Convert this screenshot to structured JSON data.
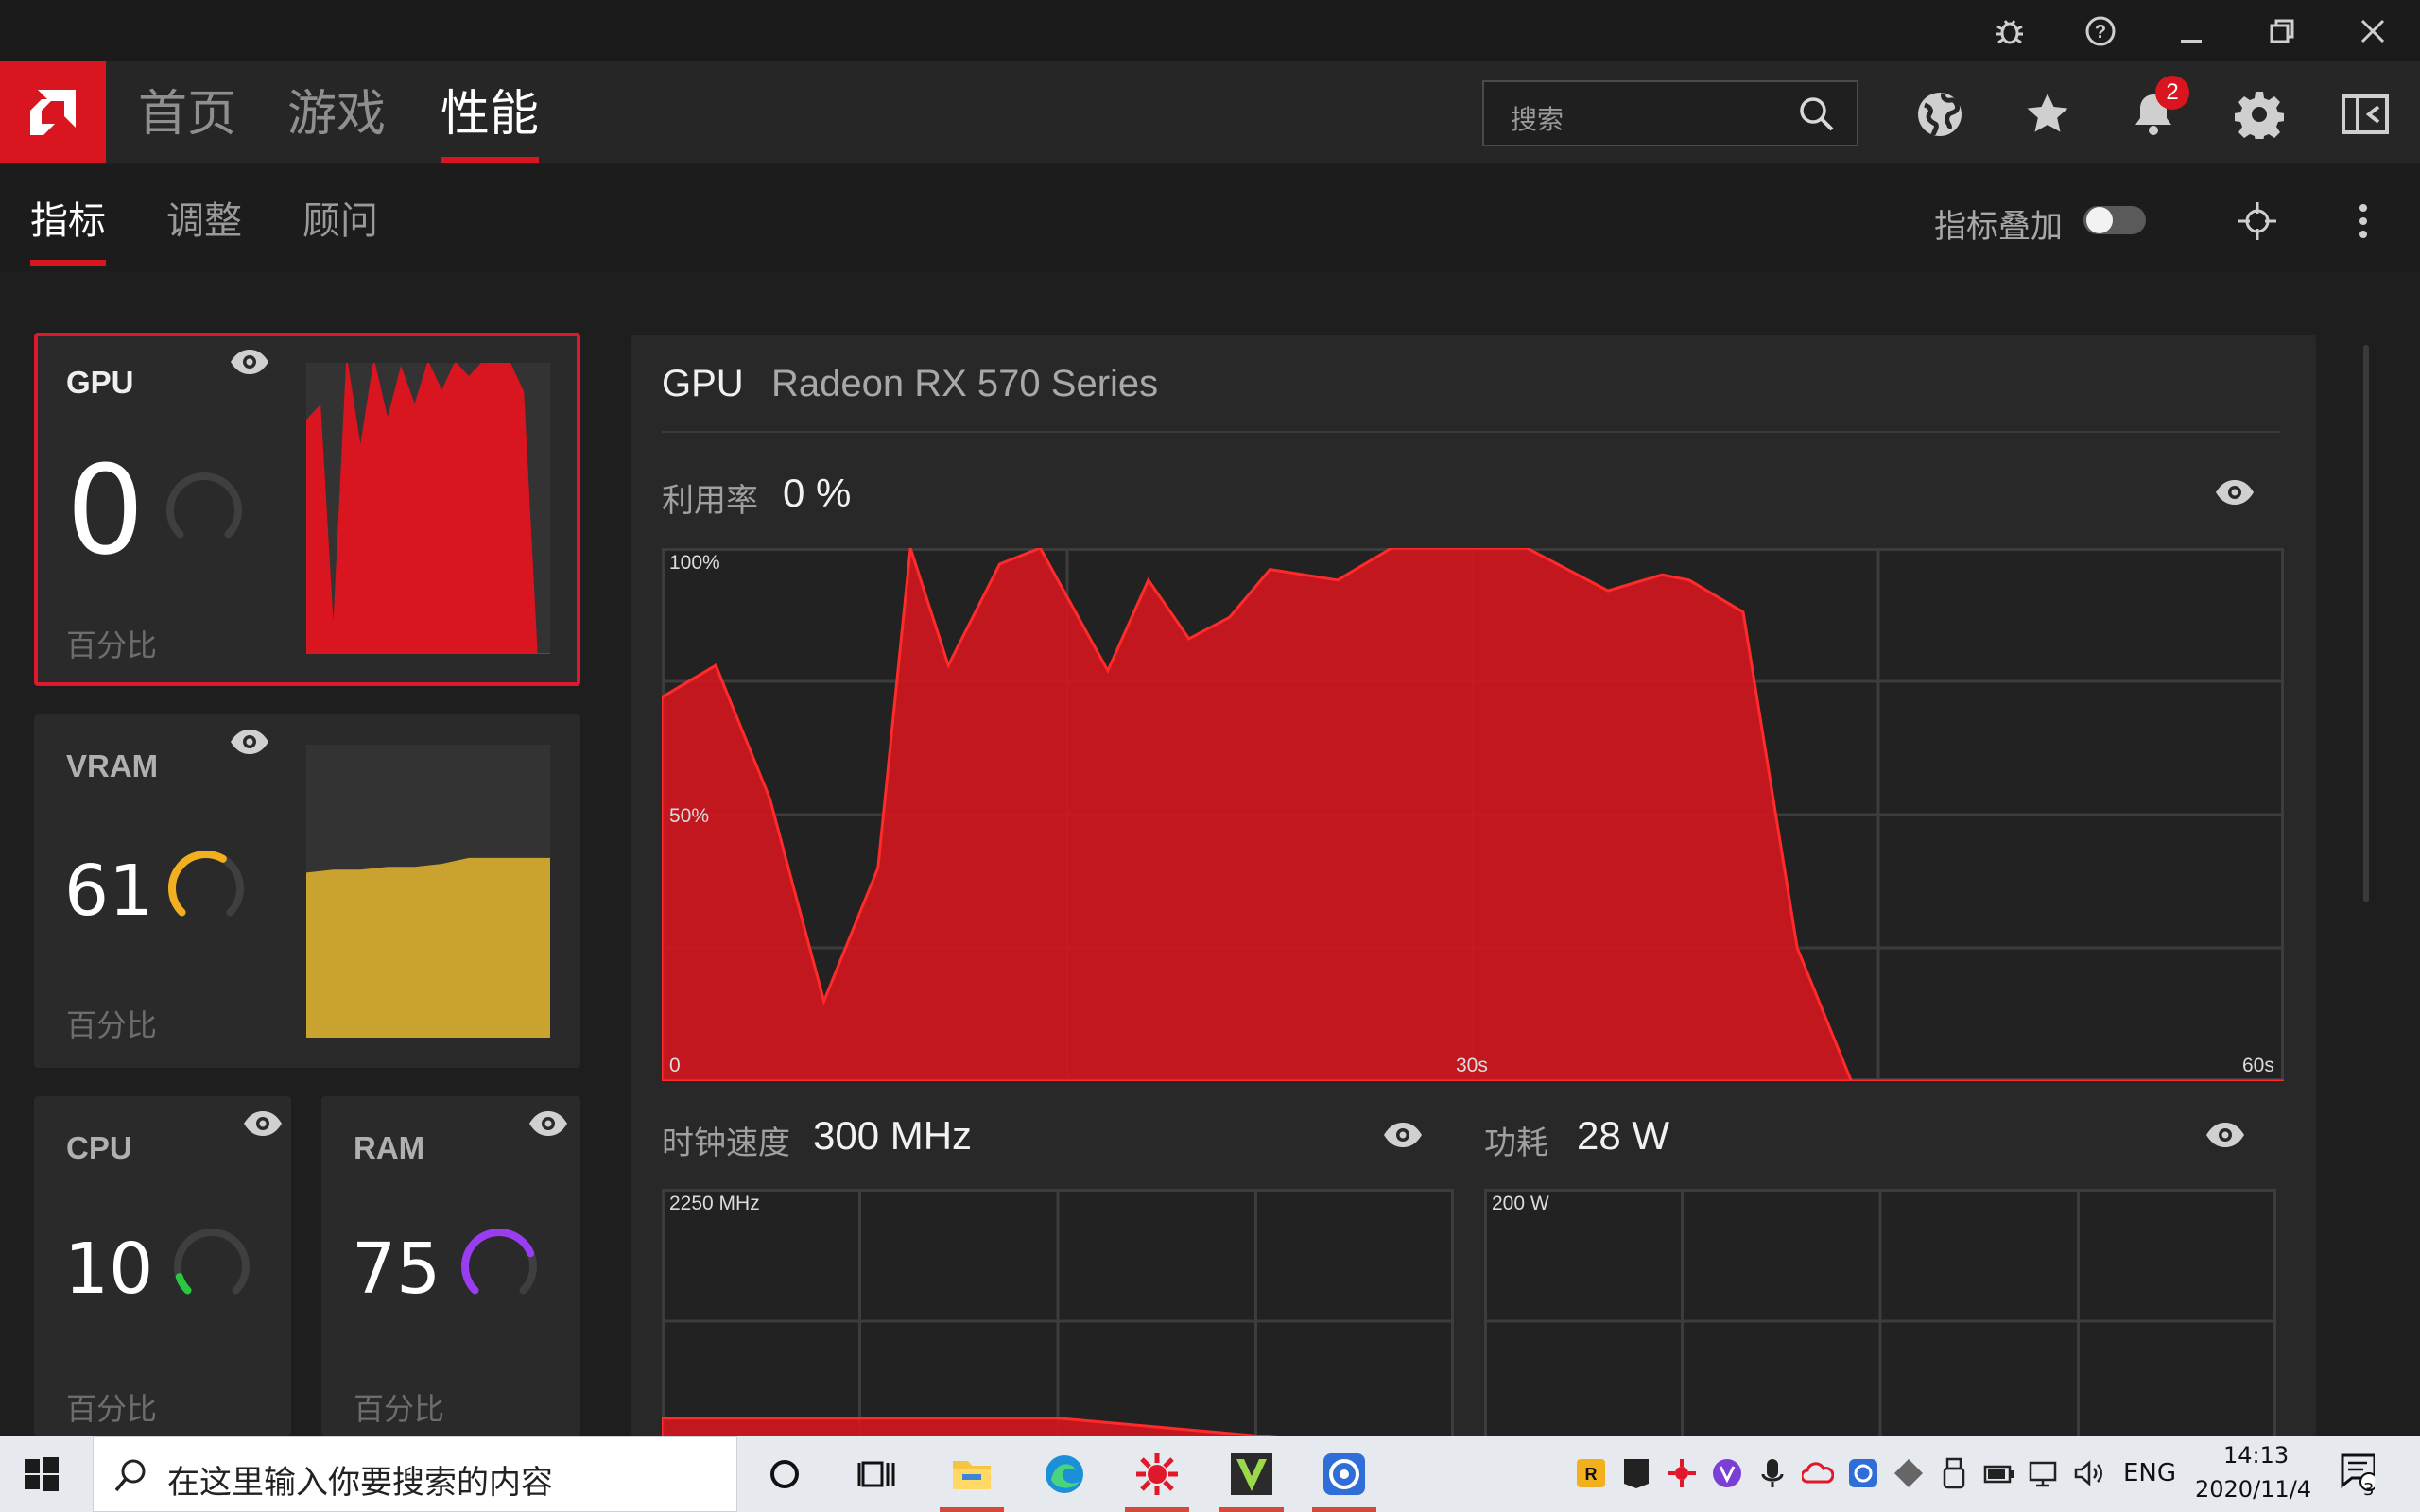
{
  "nav": {
    "tabs": [
      "首页",
      "游戏",
      "性能"
    ],
    "search_placeholder": "搜索",
    "notification_count": "2"
  },
  "subnav": {
    "tabs": [
      "指标",
      "调整",
      "顾问"
    ],
    "overlay_label": "指标叠加",
    "overlay_enabled": false
  },
  "cards": {
    "gpu": {
      "title": "GPU",
      "value": "0",
      "unit": "百分比",
      "gauge": 0,
      "gauge_color": "#555555"
    },
    "vram": {
      "title": "VRAM",
      "value": "61",
      "unit": "百分比",
      "gauge": 0.61,
      "gauge_color": "#f2b01e"
    },
    "cpu": {
      "title": "CPU",
      "value": "10",
      "unit": "百分比",
      "gauge": 0.1,
      "gauge_color": "#28c840"
    },
    "ram": {
      "title": "RAM",
      "value": "75",
      "unit": "百分比",
      "gauge": 0.75,
      "gauge_color": "#9a3cf0"
    }
  },
  "panel": {
    "title": "GPU",
    "subtitle": "Radeon RX 570 Series",
    "utilization": {
      "label": "利用率",
      "value": "0 %"
    },
    "clock": {
      "label": "时钟速度",
      "value": "300 MHz"
    },
    "power": {
      "label": "功耗",
      "value": "28 W"
    }
  },
  "chart_data": [
    {
      "type": "area",
      "title": "利用率",
      "y_labels": [
        "100%",
        "50%",
        "0"
      ],
      "x_labels": [
        "30s",
        "60s"
      ],
      "xlim": [
        0,
        60
      ],
      "ylim": [
        0,
        100
      ],
      "color": "#d9161f",
      "x": [
        0,
        2,
        4,
        6,
        8,
        9.2,
        10.6,
        12.5,
        14,
        16.5,
        18,
        19.5,
        21,
        22.5,
        25,
        27,
        30,
        32,
        35,
        37,
        38,
        40,
        42,
        44,
        45.3,
        47,
        60
      ],
      "values": [
        72,
        78,
        53,
        15,
        40,
        100,
        78,
        97,
        100,
        77,
        94,
        83,
        87,
        96,
        94,
        100,
        100,
        100,
        92,
        95,
        94,
        88,
        25,
        0,
        0,
        0,
        0
      ]
    },
    {
      "type": "area",
      "title": "时钟速度",
      "y_labels": [
        "2250 MHz"
      ],
      "ylim": [
        0,
        2250
      ],
      "color": "#d9161f",
      "x": [
        0,
        15,
        30,
        60
      ],
      "values": [
        300,
        300,
        300,
        0
      ]
    },
    {
      "type": "area",
      "title": "功耗",
      "y_labels": [
        "200 W"
      ],
      "ylim": [
        0,
        200
      ],
      "color": "#d9161f",
      "x": [],
      "values": []
    },
    {
      "type": "area",
      "title": "GPU",
      "color": "#d9161f",
      "values": [
        80,
        85,
        5,
        100,
        70,
        100,
        80,
        98,
        85,
        100,
        90,
        100,
        95,
        100,
        100,
        100,
        90,
        0,
        0
      ]
    },
    {
      "type": "area",
      "title": "VRAM",
      "color": "#c9a230",
      "values": [
        56,
        57,
        57,
        58,
        58,
        59,
        61,
        61,
        61,
        61
      ]
    }
  ],
  "taskbar": {
    "search_placeholder": "在这里输入你要搜索的内容",
    "language": "ENG",
    "time": "14:13",
    "date": "2020/11/4",
    "notifications": "3"
  }
}
